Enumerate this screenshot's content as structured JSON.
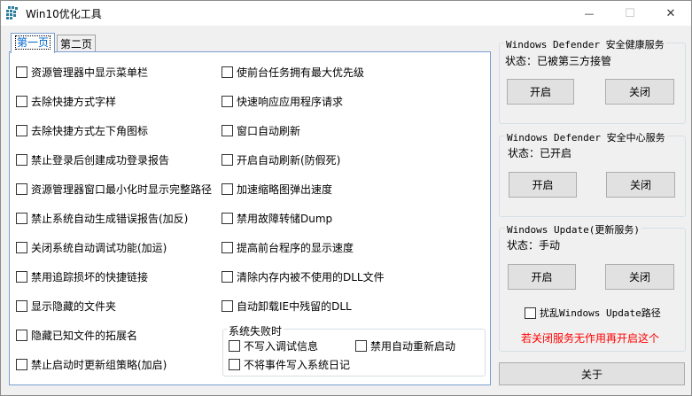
{
  "window": {
    "title": "Win10优化工具",
    "minimize": "—",
    "maximize": "☐",
    "close": "✕"
  },
  "tabs": [
    {
      "label": "第一页",
      "selected": true
    },
    {
      "label": "第二页",
      "selected": false
    }
  ],
  "options_left": [
    {
      "label": "资源管理器中显示菜单栏",
      "checked": false
    },
    {
      "label": "去除快捷方式字样",
      "checked": false
    },
    {
      "label": "去除快捷方式左下角图标",
      "checked": false
    },
    {
      "label": "禁止登录后创建成功登录报告",
      "checked": false
    },
    {
      "label": "资源管理器窗口最小化时显示完整路径",
      "checked": false
    },
    {
      "label": "禁止系统自动生成错误报告(加反)",
      "checked": false
    },
    {
      "label": "关闭系统自动调试功能(加运)",
      "checked": false
    },
    {
      "label": "禁用追踪损坏的快捷链接",
      "checked": false
    },
    {
      "label": "显示隐藏的文件夹",
      "checked": false
    },
    {
      "label": "隐藏已知文件的拓展名",
      "checked": false
    },
    {
      "label": "禁止启动时更新组策略(加启)",
      "checked": false
    }
  ],
  "options_right": [
    {
      "label": "使前台任务拥有最大优先级",
      "checked": false
    },
    {
      "label": "快速响应应用程序请求",
      "checked": false
    },
    {
      "label": "窗口自动刷新",
      "checked": false
    },
    {
      "label": "开启自动刷新(防假死)",
      "checked": false
    },
    {
      "label": "加速缩略图弹出速度",
      "checked": false
    },
    {
      "label": "禁用故障转储Dump",
      "checked": false
    },
    {
      "label": "提高前台程序的显示速度",
      "checked": false
    },
    {
      "label": "清除内存内被不使用的DLL文件",
      "checked": false
    },
    {
      "label": "自动卸载IE中残留的DLL",
      "checked": false
    }
  ],
  "system_failure": {
    "title": "系统失败时",
    "no_debug_info": "不写入调试信息",
    "disable_auto_restart": "禁用自动重新启动",
    "no_event_log": "不将事件写入系统日记"
  },
  "defender_health": {
    "title": "Windows Defender 安全健康服务",
    "status": "状态：已被第三方接管",
    "start": "开启",
    "stop": "关闭"
  },
  "defender_center": {
    "title": "Windows Defender 安全中心服务",
    "status": "状态：已开启",
    "start": "开启",
    "stop": "关闭"
  },
  "windows_update": {
    "title": "Windows Update(更新服务)",
    "status": "状态：手动",
    "start": "开启",
    "stop": "关闭",
    "scramble_path": "扰乱Windows Update路径",
    "warning": "若关闭服务无作用再开启这个"
  },
  "about_button": "关于",
  "colors": {
    "accent": "#0066cc",
    "warning": "#ff0000",
    "panel_border": "#7a9fcf"
  }
}
